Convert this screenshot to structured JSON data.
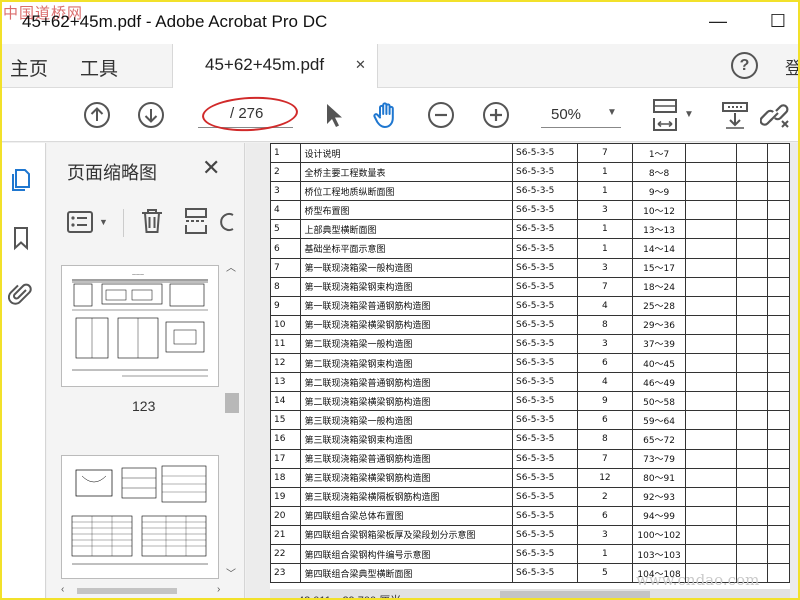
{
  "window": {
    "title": "45+62+45m.pdf - Adobe Acrobat Pro DC",
    "minimize": "—",
    "maximize": "☐"
  },
  "watermarks": {
    "top_left": "中国道桥网",
    "bottom_right": "www.cndao.com"
  },
  "tabs": {
    "home": "主页",
    "tools": "工具",
    "document": "45+62+45m.pdf",
    "help": "?",
    "right_partial": "登"
  },
  "toolbar": {
    "page_current": "",
    "page_total": "/ 276",
    "zoom": "50%",
    "icons": [
      "arrow-up-circle-icon",
      "arrow-down-circle-icon",
      "cursor-icon",
      "hand-icon",
      "zoom-out-icon",
      "zoom-in-icon",
      "fit-page-icon",
      "scroll-mode-icon",
      "link-icon"
    ],
    "highlight_color": "#d12a2a"
  },
  "thumbnails": {
    "title": "页面缩略图",
    "pages": [
      {
        "label": "123"
      },
      {
        "label": ""
      }
    ]
  },
  "status": {
    "dimensions_partial": "42.011 x 29.700 厘米"
  },
  "table": {
    "rows": [
      {
        "no": "1",
        "name": "设计说明",
        "code": "S6-5-3-5",
        "count": "7",
        "range": "1～7"
      },
      {
        "no": "2",
        "name": "全桥主要工程数量表",
        "code": "S6-5-3-5",
        "count": "1",
        "range": "8～8"
      },
      {
        "no": "3",
        "name": "桥位工程地质纵断面图",
        "code": "S6-5-3-5",
        "count": "1",
        "range": "9～9"
      },
      {
        "no": "4",
        "name": "桥型布置图",
        "code": "S6-5-3-5",
        "count": "3",
        "range": "10～12"
      },
      {
        "no": "5",
        "name": "上部典型横断面图",
        "code": "S6-5-3-5",
        "count": "1",
        "range": "13～13"
      },
      {
        "no": "6",
        "name": "基础坐标平面示意图",
        "code": "S6-5-3-5",
        "count": "1",
        "range": "14～14"
      },
      {
        "no": "7",
        "name": "第一联现浇箱梁一般构造图",
        "code": "S6-5-3-5",
        "count": "3",
        "range": "15～17"
      },
      {
        "no": "8",
        "name": "第一联现浇箱梁钢束构造图",
        "code": "S6-5-3-5",
        "count": "7",
        "range": "18～24"
      },
      {
        "no": "9",
        "name": "第一联现浇箱梁普通钢筋构造图",
        "code": "S6-5-3-5",
        "count": "4",
        "range": "25～28"
      },
      {
        "no": "10",
        "name": "第一联现浇箱梁横梁钢筋构造图",
        "code": "S6-5-3-5",
        "count": "8",
        "range": "29～36"
      },
      {
        "no": "11",
        "name": "第二联现浇箱梁一般构造图",
        "code": "S6-5-3-5",
        "count": "3",
        "range": "37～39"
      },
      {
        "no": "12",
        "name": "第二联现浇箱梁钢束构造图",
        "code": "S6-5-3-5",
        "count": "6",
        "range": "40～45"
      },
      {
        "no": "13",
        "name": "第二联现浇箱梁普通钢筋构造图",
        "code": "S6-5-3-5",
        "count": "4",
        "range": "46～49"
      },
      {
        "no": "14",
        "name": "第二联现浇箱梁横梁钢筋构造图",
        "code": "S6-5-3-5",
        "count": "9",
        "range": "50～58"
      },
      {
        "no": "15",
        "name": "第三联现浇箱梁一般构造图",
        "code": "S6-5-3-5",
        "count": "6",
        "range": "59～64"
      },
      {
        "no": "16",
        "name": "第三联现浇箱梁钢束构造图",
        "code": "S6-5-3-5",
        "count": "8",
        "range": "65～72"
      },
      {
        "no": "17",
        "name": "第三联现浇箱梁普通钢筋构造图",
        "code": "S6-5-3-5",
        "count": "7",
        "range": "73～79"
      },
      {
        "no": "18",
        "name": "第三联现浇箱梁横梁钢筋构造图",
        "code": "S6-5-3-5",
        "count": "12",
        "range": "80～91"
      },
      {
        "no": "19",
        "name": "第三联现浇箱梁横隔板钢筋构造图",
        "code": "S6-5-3-5",
        "count": "2",
        "range": "92～93"
      },
      {
        "no": "20",
        "name": "第四联组合梁总体布置图",
        "code": "S6-5-3-5",
        "count": "6",
        "range": "94～99"
      },
      {
        "no": "21",
        "name": "第四联组合梁钢箱梁板厚及梁段划分示意图",
        "code": "S6-5-3-5",
        "count": "3",
        "range": "100～102"
      },
      {
        "no": "22",
        "name": "第四联组合梁钢构件编号示意图",
        "code": "S6-5-3-5",
        "count": "1",
        "range": "103～103"
      },
      {
        "no": "23",
        "name": "第四联组合梁典型横断面图",
        "code": "S6-5-3-5",
        "count": "5",
        "range": "104～108"
      }
    ]
  }
}
